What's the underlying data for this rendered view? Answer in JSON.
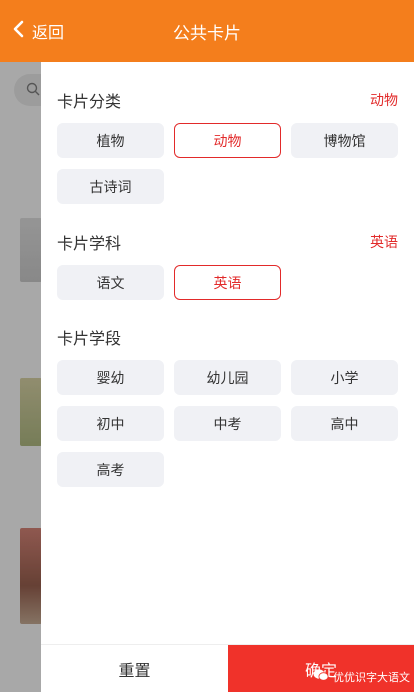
{
  "header": {
    "back_label": "返回",
    "title": "公共卡片",
    "background": "#f47e1c"
  },
  "icons": {
    "back": "chevron-left-icon",
    "search": "search-icon",
    "wechat": "wechat-icon"
  },
  "filters": {
    "category": {
      "title": "卡片分类",
      "selected": "动物",
      "options": [
        "植物",
        "动物",
        "博物馆",
        "古诗词"
      ]
    },
    "subject": {
      "title": "卡片学科",
      "selected": "英语",
      "options": [
        "语文",
        "英语"
      ]
    },
    "stage": {
      "title": "卡片学段",
      "selected": "",
      "options": [
        "婴幼",
        "幼儿园",
        "小学",
        "初中",
        "中考",
        "高中",
        "高考"
      ]
    }
  },
  "footer": {
    "reset_label": "重置",
    "confirm_label": "确定",
    "watermark": "优优识字大语文"
  },
  "colors": {
    "accent": "#e22a2a",
    "confirm": "#f0322a",
    "chip_bg": "#f0f1f5"
  }
}
